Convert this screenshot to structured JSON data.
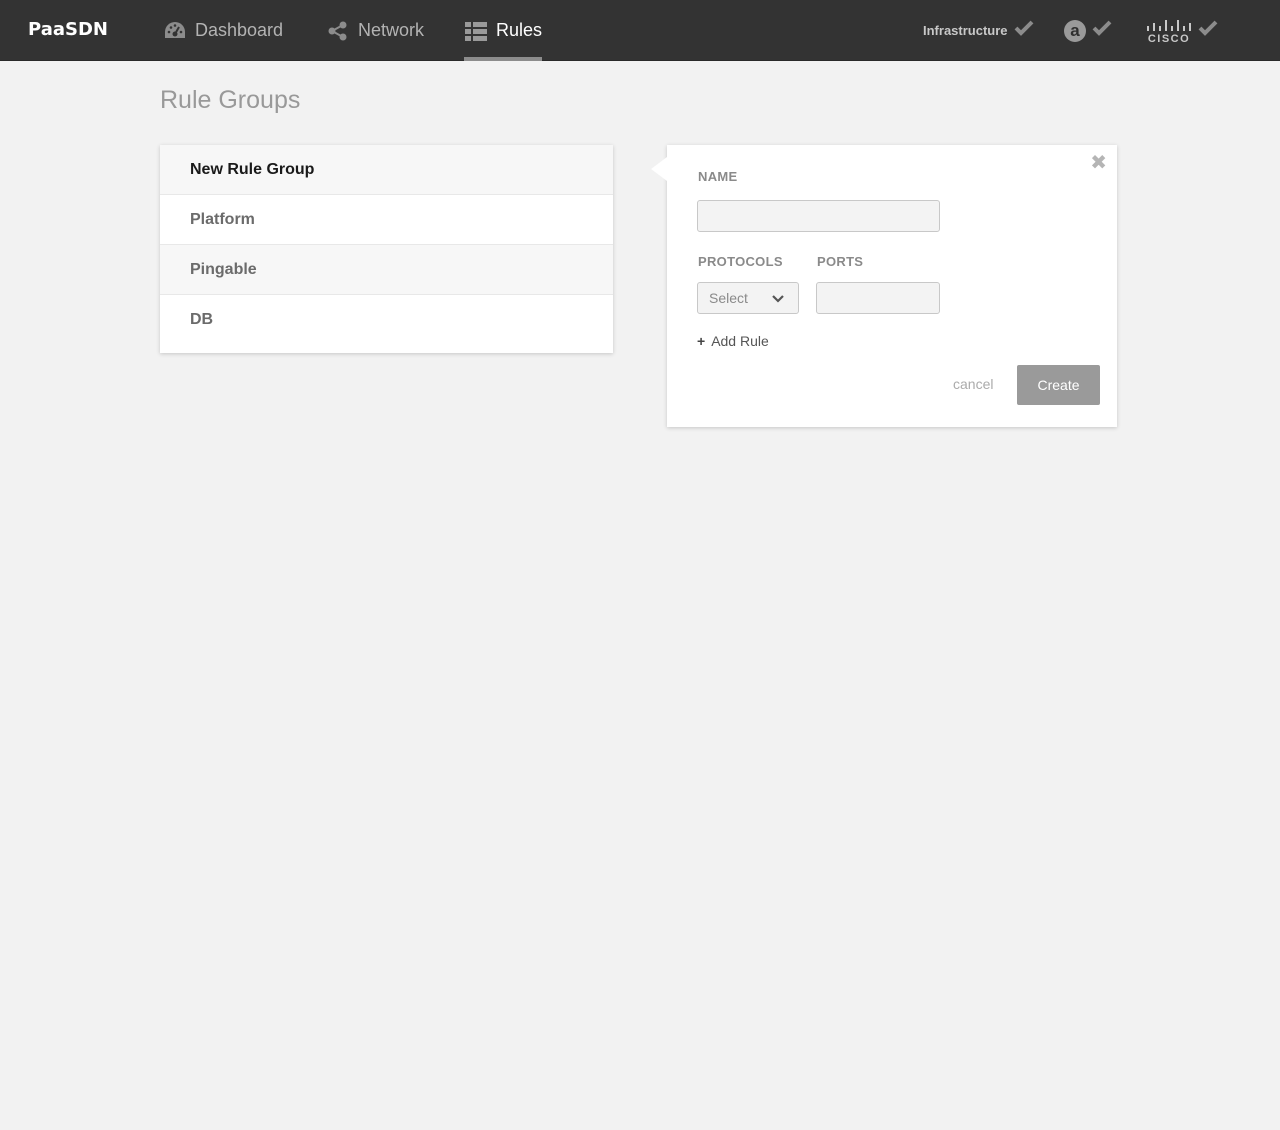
{
  "app": {
    "brand": "PaaSDN"
  },
  "nav": {
    "items": [
      {
        "label": "Dashboard",
        "icon": "dashboard-gauge-icon",
        "active": false
      },
      {
        "label": "Network",
        "icon": "share-network-icon",
        "active": false
      },
      {
        "label": "Rules",
        "icon": "list-table-icon",
        "active": true
      }
    ]
  },
  "status": {
    "infrastructure_label": "Infrastructure",
    "a_badge": "a",
    "cisco_logo_text": "CISCO"
  },
  "page": {
    "title": "Rule Groups"
  },
  "groups": [
    {
      "label": "New Rule Group"
    },
    {
      "label": "Platform"
    },
    {
      "label": "Pingable"
    },
    {
      "label": "DB"
    }
  ],
  "form": {
    "name_label": "NAME",
    "name_value": "",
    "protocols_label": "PROTOCOLS",
    "protocols_selected": "Select",
    "ports_label": "PORTS",
    "ports_value": "",
    "add_rule_label": "Add Rule",
    "cancel_label": "cancel",
    "create_label": "Create"
  },
  "colors": {
    "topbar": "#333333",
    "background": "#f2f2f2",
    "create_button": "#9a9a9a"
  }
}
